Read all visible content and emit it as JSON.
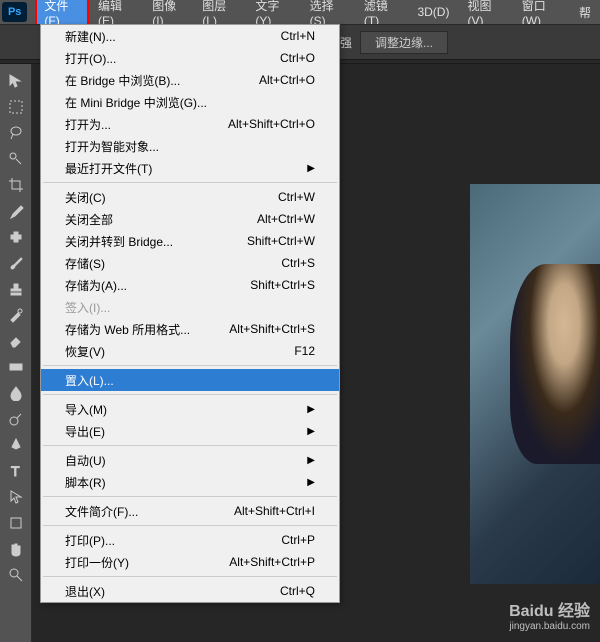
{
  "app": {
    "logo": "Ps"
  },
  "menubar": [
    {
      "label": "文件(F)",
      "active": true
    },
    {
      "label": "编辑(E)"
    },
    {
      "label": "图像(I)"
    },
    {
      "label": "图层(L)"
    },
    {
      "label": "文字(Y)"
    },
    {
      "label": "选择(S)"
    },
    {
      "label": "滤镜(T)"
    },
    {
      "label": "3D(D)"
    },
    {
      "label": "视图(V)"
    },
    {
      "label": "窗口(W)"
    },
    {
      "label": "帮"
    }
  ],
  "optbar": {
    "enhance": "自动增强",
    "refine": "调整边缘..."
  },
  "dropdown": [
    {
      "label": "新建(N)...",
      "shortcut": "Ctrl+N"
    },
    {
      "label": "打开(O)...",
      "shortcut": "Ctrl+O"
    },
    {
      "label": "在 Bridge 中浏览(B)...",
      "shortcut": "Alt+Ctrl+O"
    },
    {
      "label": "在 Mini Bridge 中浏览(G)..."
    },
    {
      "label": "打开为...",
      "shortcut": "Alt+Shift+Ctrl+O"
    },
    {
      "label": "打开为智能对象..."
    },
    {
      "label": "最近打开文件(T)",
      "submenu": true
    },
    {
      "sep": true
    },
    {
      "label": "关闭(C)",
      "shortcut": "Ctrl+W"
    },
    {
      "label": "关闭全部",
      "shortcut": "Alt+Ctrl+W"
    },
    {
      "label": "关闭并转到 Bridge...",
      "shortcut": "Shift+Ctrl+W"
    },
    {
      "label": "存储(S)",
      "shortcut": "Ctrl+S"
    },
    {
      "label": "存储为(A)...",
      "shortcut": "Shift+Ctrl+S"
    },
    {
      "label": "签入(I)...",
      "disabled": true
    },
    {
      "label": "存储为 Web 所用格式...",
      "shortcut": "Alt+Shift+Ctrl+S"
    },
    {
      "label": "恢复(V)",
      "shortcut": "F12"
    },
    {
      "sep": true
    },
    {
      "label": "置入(L)...",
      "highlighted": true
    },
    {
      "sep": true
    },
    {
      "label": "导入(M)",
      "submenu": true
    },
    {
      "label": "导出(E)",
      "submenu": true
    },
    {
      "sep": true
    },
    {
      "label": "自动(U)",
      "submenu": true
    },
    {
      "label": "脚本(R)",
      "submenu": true
    },
    {
      "sep": true
    },
    {
      "label": "文件简介(F)...",
      "shortcut": "Alt+Shift+Ctrl+I"
    },
    {
      "sep": true
    },
    {
      "label": "打印(P)...",
      "shortcut": "Ctrl+P"
    },
    {
      "label": "打印一份(Y)",
      "shortcut": "Alt+Shift+Ctrl+P"
    },
    {
      "sep": true
    },
    {
      "label": "退出(X)",
      "shortcut": "Ctrl+Q"
    }
  ],
  "watermark": {
    "brand": "Baidu 经验",
    "url": "jingyan.baidu.com"
  }
}
